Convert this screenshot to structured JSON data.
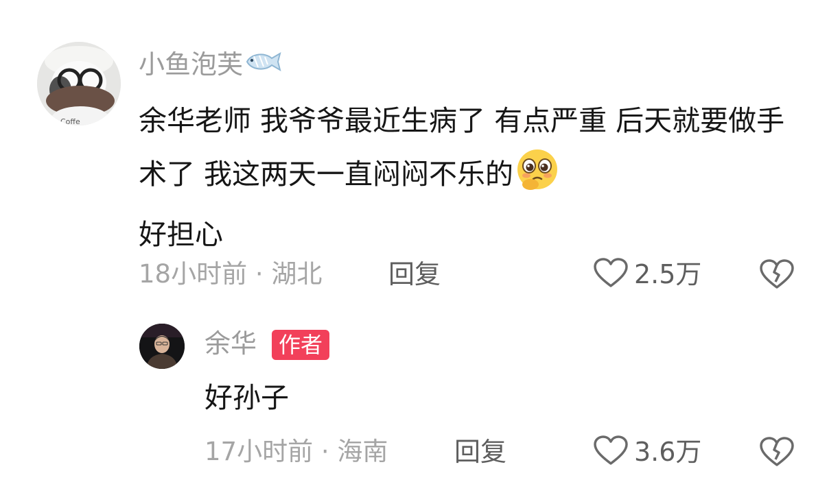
{
  "comment": {
    "username": "小鱼泡芙",
    "username_icon": "fish-icon",
    "text": "余华老师 我爷爷最近生病了 有点严重 后天就要做手术了 我这两天一直闷闷不乐的",
    "text_after_emoji": "好担心",
    "emoji_icon": "pleading-face-emoji-icon",
    "time_location": "18小时前 · 湖北",
    "reply_label": "回复",
    "like_count": "2.5万"
  },
  "reply": {
    "username": "余华",
    "badge": "作者",
    "text": "好孙子",
    "time_location": "17小时前 · 海南",
    "reply_label": "回复",
    "like_count": "3.6万"
  },
  "colors": {
    "badge_bg": "#f2405a",
    "username": "#9b9b9b",
    "meta": "#a5a5a5",
    "body_text": "#161616",
    "action_text": "#5e5e5e"
  }
}
